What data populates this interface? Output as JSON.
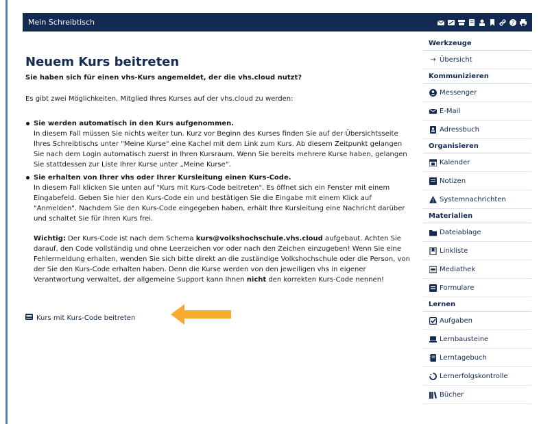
{
  "header": {
    "title": "Mein Schreibtisch",
    "icons": [
      "mail-icon",
      "chat-icon",
      "shop-icon",
      "notes-icon",
      "user-icon",
      "bookmark-icon",
      "link-icon",
      "help-icon",
      "print-icon"
    ]
  },
  "main": {
    "title": "Neuem Kurs beitreten",
    "subtitle": "Sie haben sich für einen vhs-Kurs angemeldet, der die vhs.cloud nutzt?",
    "intro": "Es gibt zwei Möglichkeiten, Mitglied Ihres Kurses auf der vhs.cloud zu werden:",
    "options": [
      {
        "title": "Sie werden automatisch in den Kurs aufgenommen.",
        "text": "In diesem Fall müssen Sie nichts weiter tun. Kurz vor Beginn des Kurses finden Sie auf der Übersichtsseite Ihres Schreibtischs unter \"Meine Kurse\" eine Kachel mit dem Link zum Kurs. Ab diesem Zeitpunkt gelangen Sie nach dem Login automatisch zuerst in Ihren Kursraum. Wenn Sie bereits mehrere Kurse haben, gelangen Sie stattdessen zur Liste Ihrer Kurse unter „Meine Kurse“."
      },
      {
        "title": "Sie erhalten von Ihrer vhs oder Ihrer Kursleitung einen Kurs-Code.",
        "text": "In diesem Fall klicken Sie unten auf \"Kurs mit Kurs-Code beitreten\". Es öffnet sich ein Fenster mit einem Eingabefeld. Geben Sie hier den Kurs-Code ein und bestätigen Sie die Eingabe mit einem Klick auf \"Anmelden\". Nachdem Sie den Kurs-Code eingegeben haben, erhält Ihre Kursleitung eine Nachricht darüber und schaltet Sie für Ihren Kurs frei."
      }
    ],
    "note": {
      "label": "Wichtig:",
      "text1": " Der Kurs-Code ist nach dem Schema ",
      "schema": "kurs@volkshochschule.vhs.cloud",
      "text2": " aufgebaut. Achten Sie darauf, den Code vollständig und ohne Leerzeichen vor oder nach den Zeichen einzugeben! Wenn Sie eine Fehlermeldung erhalten, wenden Sie sich bitte direkt an die zuständige Volkshochschule oder die Person, von der Sie den Kurs-Code erhalten haben. Denn die Kurse werden von den jeweiligen vhs in eigener Verantwortung verwaltet, der allgemeine Support kann Ihnen ",
      "nicht": "nicht",
      "text3": " den korrekten Kurs-Code nennen!"
    },
    "join_link": "Kurs mit Kurs-Code beitreten"
  },
  "sidebar": {
    "sections": [
      {
        "title": "Werkzeuge",
        "items": [
          {
            "label": "Übersicht",
            "icon": "arrow-right-icon"
          }
        ]
      },
      {
        "title": "Kommunizieren",
        "items": [
          {
            "label": "Messenger",
            "icon": "messenger-icon"
          },
          {
            "label": "E-Mail",
            "icon": "mail-icon"
          },
          {
            "label": "Adressbuch",
            "icon": "address-book-icon"
          }
        ]
      },
      {
        "title": "Organisieren",
        "items": [
          {
            "label": "Kalender",
            "icon": "calendar-icon"
          },
          {
            "label": "Notizen",
            "icon": "notes-icon"
          },
          {
            "label": "Systemnachrichten",
            "icon": "warning-icon"
          }
        ]
      },
      {
        "title": "Materialien",
        "items": [
          {
            "label": "Dateiablage",
            "icon": "folder-icon"
          },
          {
            "label": "Linkliste",
            "icon": "bookmark-icon"
          },
          {
            "label": "Mediathek",
            "icon": "media-icon"
          },
          {
            "label": "Formulare",
            "icon": "form-icon"
          }
        ]
      },
      {
        "title": "Lernen",
        "items": [
          {
            "label": "Aufgaben",
            "icon": "checkbox-icon"
          },
          {
            "label": "Lernbausteine",
            "icon": "laptop-icon"
          },
          {
            "label": "Lerntagebuch",
            "icon": "diary-icon"
          },
          {
            "label": "Lernerfolgskontrolle",
            "icon": "progress-icon"
          },
          {
            "label": "Bücher",
            "icon": "books-icon"
          }
        ]
      }
    ]
  },
  "colors": {
    "header_bg": "#132a52",
    "accent_arrow": "#f5a623",
    "text_link": "#132a52"
  }
}
